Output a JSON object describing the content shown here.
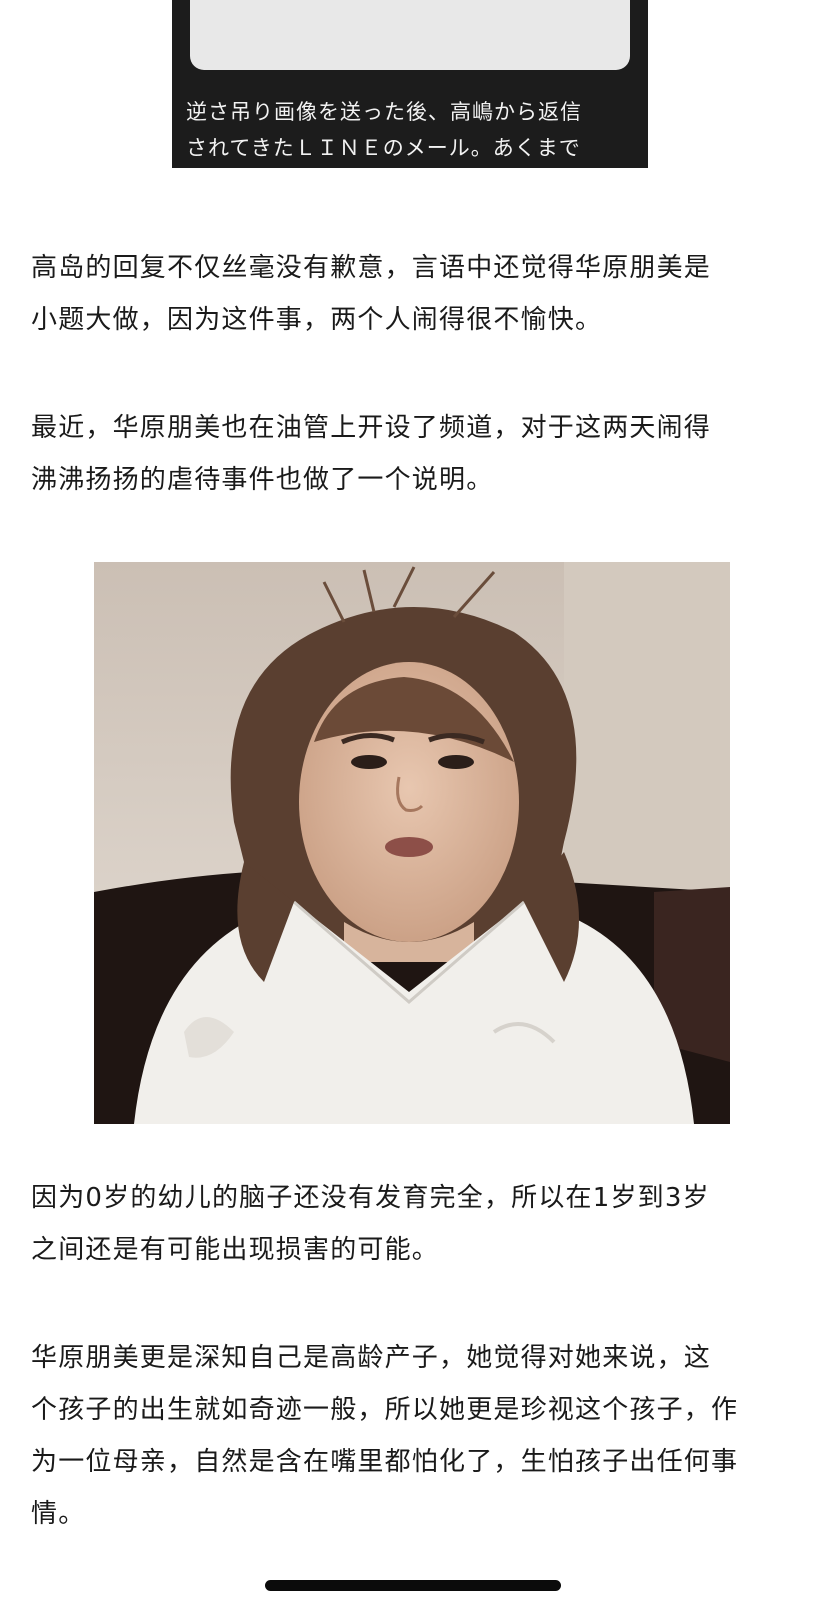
{
  "embedded_figure": {
    "caption_lines": [
      "逆さ吊り画像を送った後、高嶋から返信",
      "されてきたＬＩＮＥのメール。あくまで"
    ]
  },
  "paragraphs": [
    [
      "高岛的回复不仅丝毫没有歉意，言语中还觉得华原朋美是",
      "小题大做，因为这件事，两个人闹得很不愉快。"
    ],
    [
      "最近，华原朋美也在油管上开设了频道，对于这两天闹得",
      "沸沸扬扬的虐待事件也做了一个说明。"
    ],
    [
      "因为0岁的幼儿的脑子还没有发育完全，所以在1岁到3岁",
      "之间还是有可能出现损害的可能。"
    ],
    [
      "华原朋美更是深知自己是高龄产子，她觉得对她来说，这",
      "个孩子的出生就如奇迹一般，所以她更是珍视这个孩子，作",
      "为一位母亲，自然是含在嘴里都怕化了，生怕孩子出任何事",
      "情。"
    ]
  ],
  "colors": {
    "text": "#1a1a1a",
    "figure_bg": "#1c1c1c",
    "home_indicator": "#0b0b0b"
  }
}
